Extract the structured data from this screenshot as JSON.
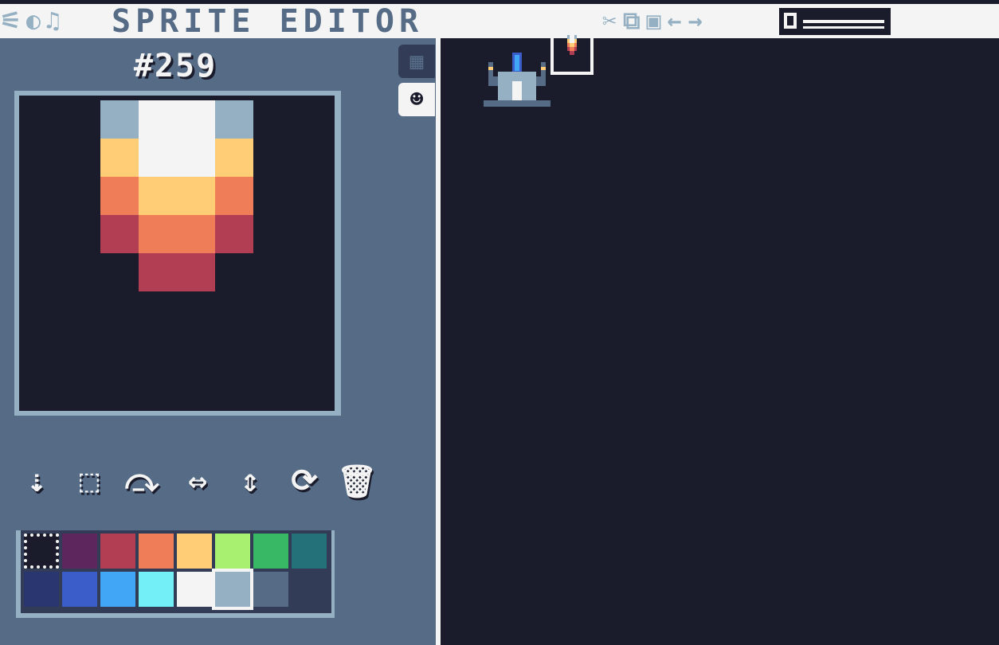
{
  "topbar": {
    "title": "SPRITE EDITOR",
    "mode_icons": [
      {
        "name": "code-mode-icon",
        "glyph": "⚟"
      },
      {
        "name": "map-mode-icon",
        "glyph": "◐"
      },
      {
        "name": "music-mode-icon",
        "glyph": "♫"
      }
    ],
    "tool_icons": [
      {
        "name": "cut-icon",
        "glyph": "✂"
      },
      {
        "name": "copy-icon",
        "glyph": "⧉"
      },
      {
        "name": "paste-icon",
        "glyph": "▣"
      },
      {
        "name": "undo-icon",
        "glyph": "←"
      },
      {
        "name": "redo-icon",
        "glyph": "→"
      }
    ],
    "bank_slider": {
      "level": 0
    }
  },
  "sprite_editor": {
    "sprite_id": "#259",
    "side_tabs": [
      {
        "name": "tab-sprite-grid",
        "glyph": "▦"
      },
      {
        "name": "tab-sprites-face",
        "glyph": "☻"
      }
    ],
    "tools": [
      {
        "name": "brush-tool",
        "glyph": "⇣"
      },
      {
        "name": "select-tool",
        "glyph": "⬚"
      },
      {
        "name": "fill-tool",
        "glyph": "⤼"
      },
      {
        "name": "flip-horizontal-tool",
        "glyph": "⇔"
      },
      {
        "name": "flip-vertical-tool",
        "glyph": "⇕"
      },
      {
        "name": "rotate-tool",
        "glyph": "⟳"
      },
      {
        "name": "delete-tool",
        "glyph": "🗑"
      }
    ]
  },
  "colors": {
    "background": "#1a1c2c",
    "panel": "#566c86",
    "highlight": "#f4f4f4"
  },
  "palette": [
    "#1a1c2c",
    "#5d275d",
    "#b13e53",
    "#ef7d57",
    "#ffcd75",
    "#a7f070",
    "#38b764",
    "#257179",
    "#29366f",
    "#3b5dc9",
    "#41a6f6",
    "#73eff7",
    "#f4f4f4",
    "#94b0c2",
    "#566c86",
    "#333c57"
  ],
  "selected_color_index": 13,
  "sprite_pixels": [
    [
      0,
      0,
      13,
      12,
      12,
      13,
      0,
      0
    ],
    [
      0,
      0,
      4,
      12,
      12,
      4,
      0,
      0
    ],
    [
      0,
      0,
      3,
      4,
      4,
      3,
      0,
      0
    ],
    [
      0,
      0,
      2,
      3,
      3,
      2,
      0,
      0
    ],
    [
      0,
      0,
      0,
      2,
      2,
      0,
      0,
      0
    ],
    [
      0,
      0,
      0,
      0,
      0,
      0,
      0,
      0
    ],
    [
      0,
      0,
      0,
      0,
      0,
      0,
      0,
      0
    ],
    [
      0,
      0,
      0,
      0,
      0,
      0,
      0,
      0
    ]
  ]
}
